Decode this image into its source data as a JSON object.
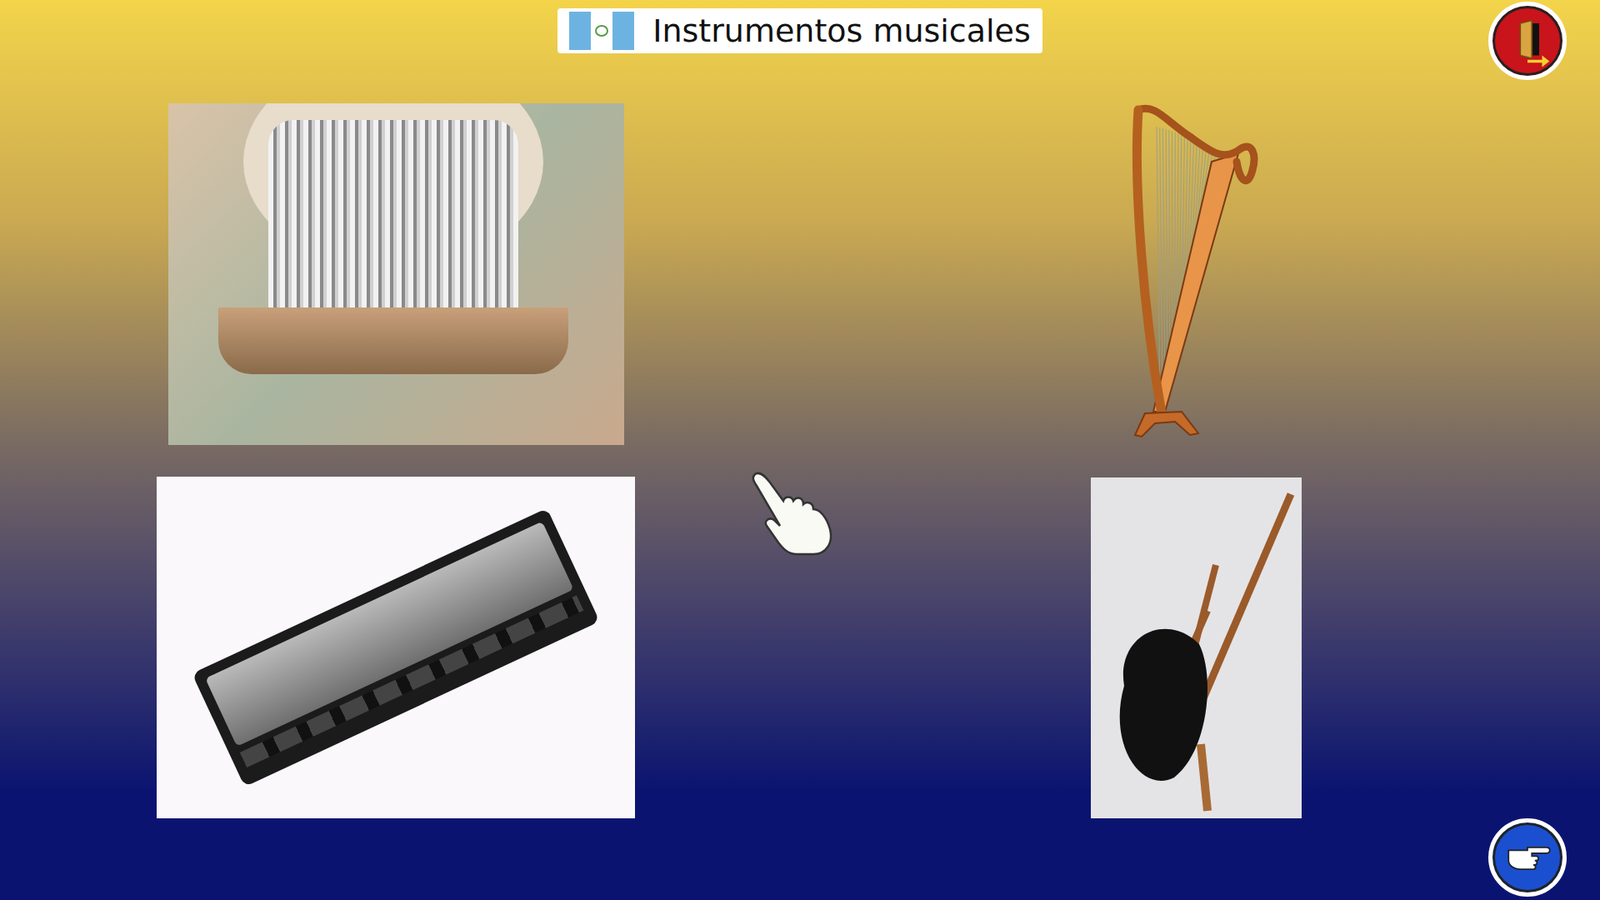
{
  "header": {
    "title": "Instrumentos musicales"
  },
  "cards": [
    {
      "kind": "organ-photo"
    },
    {
      "kind": "harp-drawing"
    },
    {
      "kind": "harmonica-photo"
    },
    {
      "kind": "bagpipe-photo"
    }
  ]
}
